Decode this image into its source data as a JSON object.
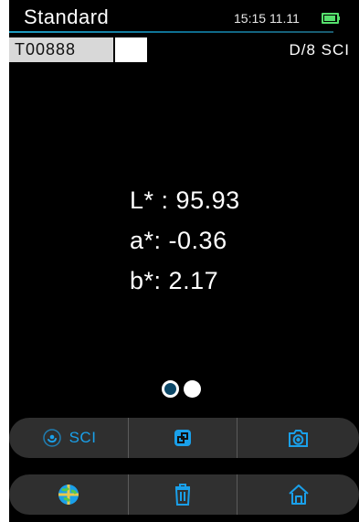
{
  "header": {
    "title": "Standard",
    "time": "15:15",
    "date": "11.11",
    "battery_color": "#56e06d"
  },
  "sample": {
    "id": "T00888",
    "mode": "D/8 SCI",
    "swatch_color": "#ffffff"
  },
  "readings": {
    "l_label": "L* :",
    "l_value": "95.93",
    "a_label": "a*:",
    "a_value": "-0.36",
    "b_label": "b*:",
    "b_value": "2.17"
  },
  "pagination": {
    "current_page": 1,
    "total_pages": 2
  },
  "toolbar": {
    "sci_label": "SCI"
  },
  "icons": {
    "measure_mode": "sci-icon",
    "compare": "compare-icon",
    "camera": "camera-icon",
    "globe": "globe-icon",
    "delete": "trash-icon",
    "home": "home-icon"
  },
  "accent_color": "#1aa0ea"
}
